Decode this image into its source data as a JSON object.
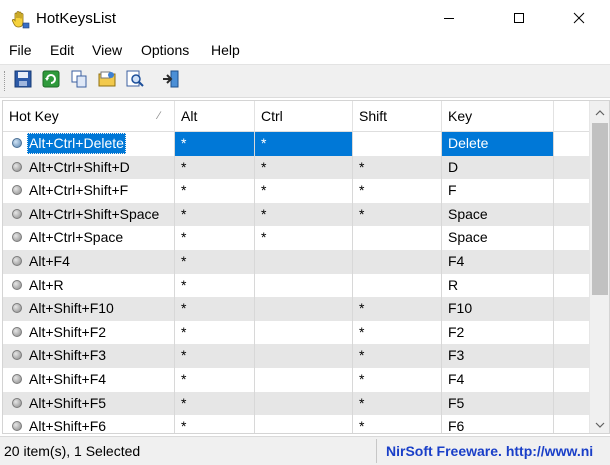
{
  "window": {
    "title": "HotKeysList",
    "icons": {
      "app": "hand-key-icon",
      "minimize": "minimize-icon",
      "maximize": "maximize-icon",
      "close": "close-icon"
    }
  },
  "menu": [
    "File",
    "Edit",
    "View",
    "Options",
    "Help"
  ],
  "toolbar": {
    "buttons": [
      "save-icon",
      "refresh-icon",
      "copy-icon",
      "html-report-icon",
      "find-icon",
      "exit-icon"
    ]
  },
  "table": {
    "columns": [
      "Hot Key",
      "Alt",
      "Ctrl",
      "Shift",
      "Key"
    ],
    "sort_column": "Hot Key",
    "rows": [
      {
        "hotkey": "Alt+Ctrl+Delete",
        "alt": "*",
        "ctrl": "*",
        "shift": "",
        "key": "Delete",
        "selected": true
      },
      {
        "hotkey": "Alt+Ctrl+Shift+D",
        "alt": "*",
        "ctrl": "*",
        "shift": "*",
        "key": "D"
      },
      {
        "hotkey": "Alt+Ctrl+Shift+F",
        "alt": "*",
        "ctrl": "*",
        "shift": "*",
        "key": "F"
      },
      {
        "hotkey": "Alt+Ctrl+Shift+Space",
        "alt": "*",
        "ctrl": "*",
        "shift": "*",
        "key": "Space"
      },
      {
        "hotkey": "Alt+Ctrl+Space",
        "alt": "*",
        "ctrl": "*",
        "shift": "",
        "key": "Space"
      },
      {
        "hotkey": "Alt+F4",
        "alt": "*",
        "ctrl": "",
        "shift": "",
        "key": "F4"
      },
      {
        "hotkey": "Alt+R",
        "alt": "*",
        "ctrl": "",
        "shift": "",
        "key": "R"
      },
      {
        "hotkey": "Alt+Shift+F10",
        "alt": "*",
        "ctrl": "",
        "shift": "*",
        "key": "F10"
      },
      {
        "hotkey": "Alt+Shift+F2",
        "alt": "*",
        "ctrl": "",
        "shift": "*",
        "key": "F2"
      },
      {
        "hotkey": "Alt+Shift+F3",
        "alt": "*",
        "ctrl": "",
        "shift": "*",
        "key": "F3"
      },
      {
        "hotkey": "Alt+Shift+F4",
        "alt": "*",
        "ctrl": "",
        "shift": "*",
        "key": "F4"
      },
      {
        "hotkey": "Alt+Shift+F5",
        "alt": "*",
        "ctrl": "",
        "shift": "*",
        "key": "F5"
      },
      {
        "hotkey": "Alt+Shift+F6",
        "alt": "*",
        "ctrl": "",
        "shift": "*",
        "key": "F6"
      }
    ]
  },
  "status": {
    "count": "20 item(s), 1 Selected",
    "credit": "NirSoft Freeware.  http://www.ni"
  },
  "colors": {
    "selection": "#0078d7",
    "alt_row": "#e6e6e6",
    "credit": "#1a3fc8"
  }
}
